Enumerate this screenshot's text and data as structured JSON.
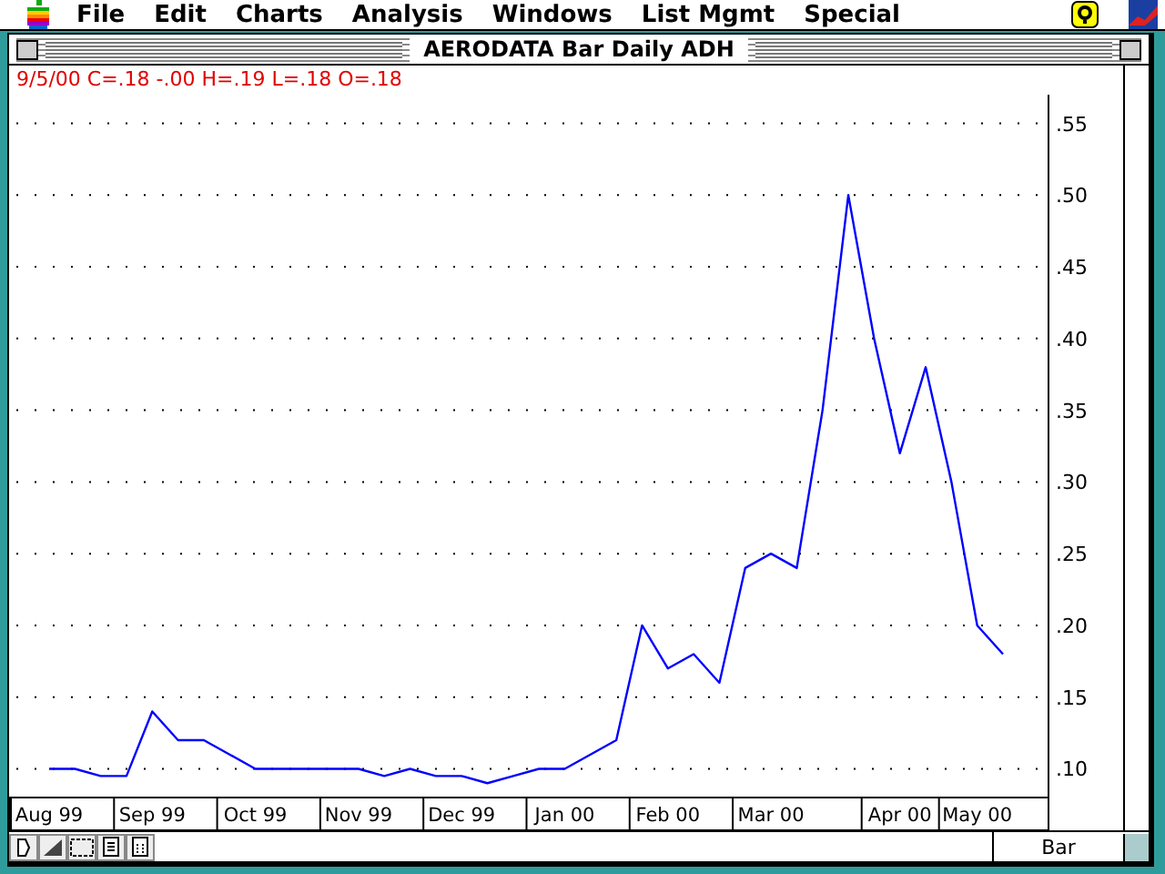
{
  "menu_bar": {
    "items": [
      "File",
      "Edit",
      "Charts",
      "Analysis",
      "Windows",
      "List Mgmt",
      "Special"
    ]
  },
  "window": {
    "title": "AERODATA Bar Daily ADH"
  },
  "quote_line": "9/5/00 C=.18 -.00 H=.19 L=.18 O=.18",
  "chart": {
    "chart_data": {
      "type": "line",
      "grid": true,
      "ylim": [
        0.08,
        0.57
      ],
      "yticks": [
        {
          "value": 0.1,
          "label": ".10"
        },
        {
          "value": 0.15,
          "label": ".15"
        },
        {
          "value": 0.2,
          "label": ".20"
        },
        {
          "value": 0.25,
          "label": ".25"
        },
        {
          "value": 0.3,
          "label": ".30"
        },
        {
          "value": 0.35,
          "label": ".35"
        },
        {
          "value": 0.4,
          "label": ".40"
        },
        {
          "value": 0.45,
          "label": ".45"
        },
        {
          "value": 0.5,
          "label": ".50"
        },
        {
          "value": 0.55,
          "label": ".55"
        }
      ],
      "categories": [
        "Aug 99",
        null,
        null,
        null,
        "Sep 99",
        null,
        null,
        null,
        "Oct 99",
        null,
        null,
        null,
        "Nov 99",
        null,
        null,
        null,
        "Dec 99",
        null,
        null,
        null,
        "Jan 00",
        null,
        null,
        null,
        "Feb 00",
        null,
        null,
        null,
        "Mar 00",
        null,
        null,
        null,
        null,
        "Apr 00",
        null,
        null,
        "May 00",
        null
      ],
      "series": [
        {
          "color": "#0000ff",
          "values": [
            0.1,
            0.1,
            0.095,
            0.095,
            0.14,
            0.12,
            0.12,
            0.11,
            0.1,
            0.1,
            0.1,
            0.1,
            0.1,
            0.095,
            0.1,
            0.095,
            0.095,
            0.09,
            0.095,
            0.1,
            0.1,
            0.11,
            0.12,
            0.2,
            0.17,
            0.18,
            0.16,
            0.24,
            0.25,
            0.24,
            0.35,
            0.5,
            0.4,
            0.32,
            0.38,
            0.3,
            0.2,
            0.18
          ]
        }
      ]
    }
  },
  "bottom_bar": {
    "chart_type": "Bar"
  }
}
